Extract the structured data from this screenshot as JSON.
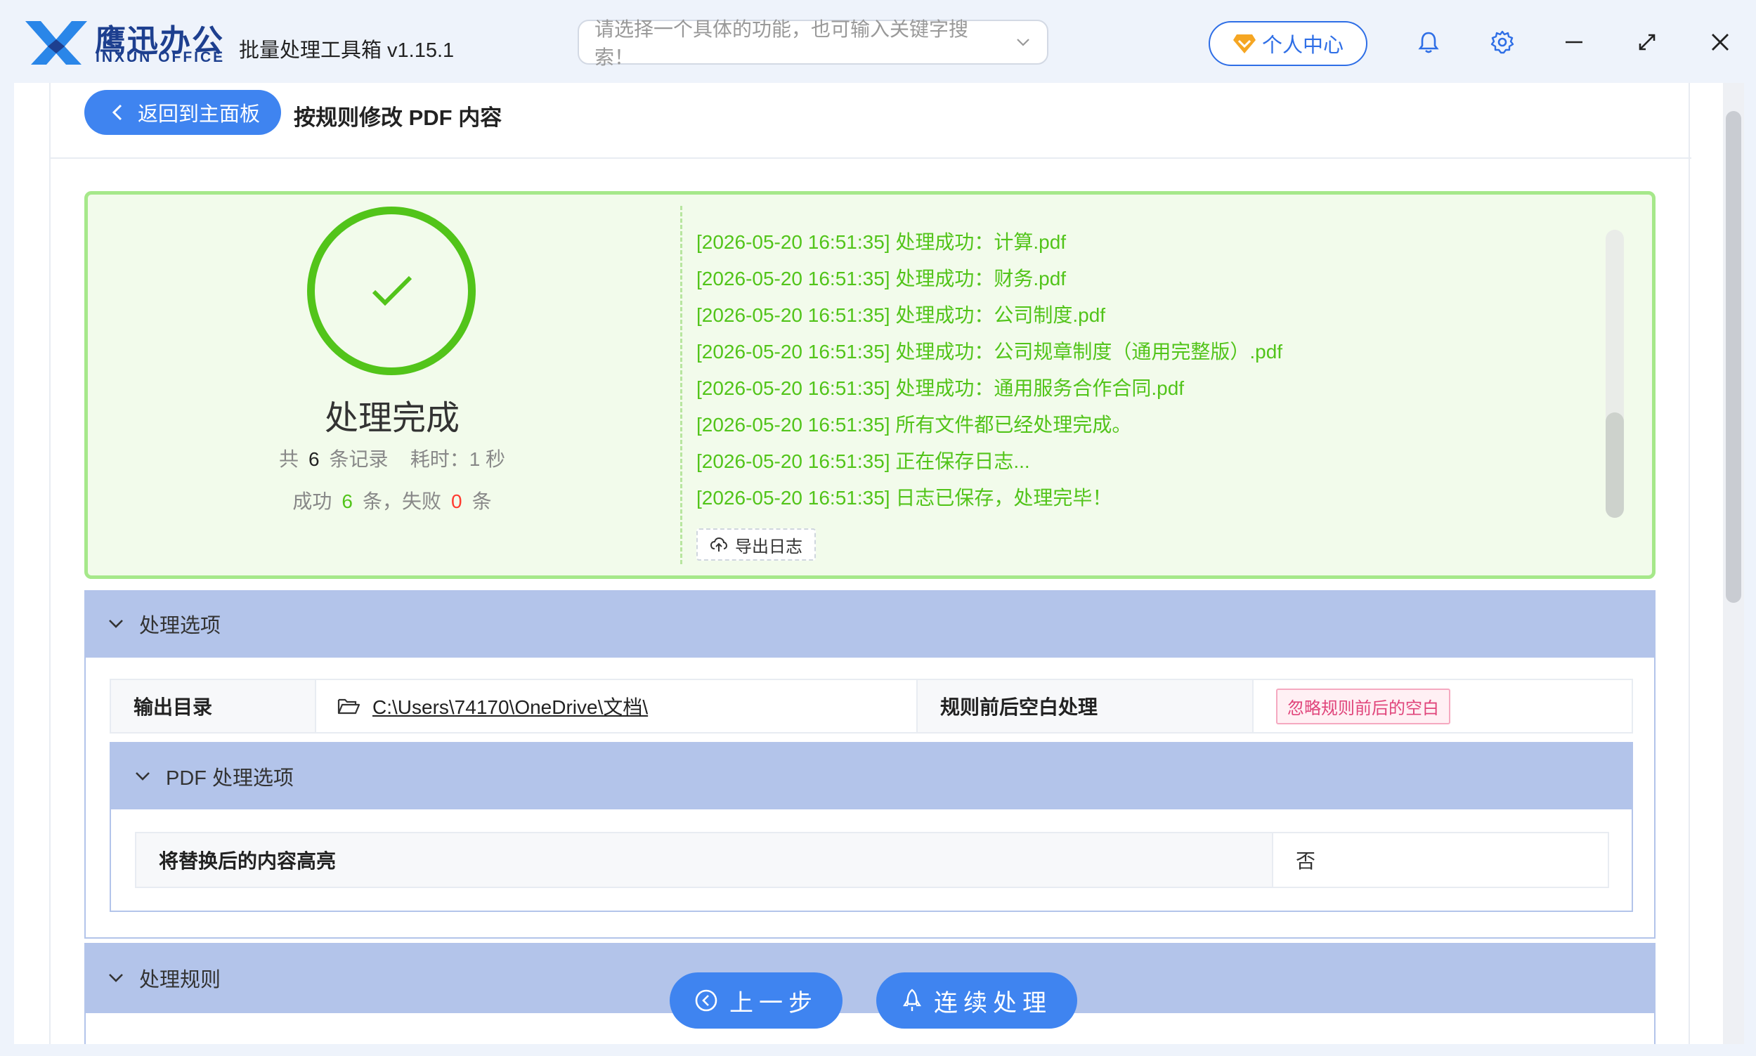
{
  "titlebar": {
    "brand_cn": "鹰迅办公",
    "brand_en": "INXUN OFFICE",
    "app_title": "批量处理工具箱 v1.15.1",
    "search_placeholder": "请选择一个具体的功能，也可输入关键字搜索！",
    "user_center": "个人中心",
    "icons": [
      "bell-icon",
      "gear-icon",
      "minimize-icon",
      "maximize-icon",
      "close-icon"
    ]
  },
  "header": {
    "back_label": "返回到主面板",
    "page_title": "按规则修改 PDF 内容"
  },
  "result": {
    "title": "处理完成",
    "total_prefix": "共",
    "total_count": "6",
    "total_suffix": "条记录",
    "time_label": "耗时：1 秒",
    "success_label": "成功",
    "success_count": "6",
    "fail_label": "条，失败",
    "fail_count": "0",
    "fail_suffix": "条",
    "logs": [
      "[2026-05-20 16:51:35] 处理成功：计算.pdf",
      "[2026-05-20 16:51:35] 处理成功：财务.pdf",
      "[2026-05-20 16:51:35] 处理成功：公司制度.pdf",
      "[2026-05-20 16:51:35] 处理成功：公司规章制度（通用完整版）.pdf",
      "[2026-05-20 16:51:35] 处理成功：通用服务合作合同.pdf",
      "[2026-05-20 16:51:35] 所有文件都已经处理完成。",
      "[2026-05-20 16:51:35] 正在保存日志...",
      "[2026-05-20 16:51:35] 日志已保存，处理完毕！"
    ],
    "export_label": "导出日志"
  },
  "options": {
    "section_title": "处理选项",
    "output_dir_label": "输出目录",
    "output_dir_value": "C:\\Users\\74170\\OneDrive\\文档\\",
    "whitespace_label": "规则前后空白处理",
    "whitespace_value": "忽略规则前后的空白",
    "pdf_section_title": "PDF 处理选项",
    "highlight_label": "将替换后的内容高亮",
    "highlight_value": "否"
  },
  "rules": {
    "section_title": "处理规则"
  },
  "footer": {
    "prev_label": "上一步",
    "continue_label": "连续处理"
  },
  "colors": {
    "accent": "#3f84f0",
    "success": "#52c41a",
    "fail": "#ff3b30",
    "section_bg": "#b3c4ea",
    "brand": "#1d3f8f"
  }
}
